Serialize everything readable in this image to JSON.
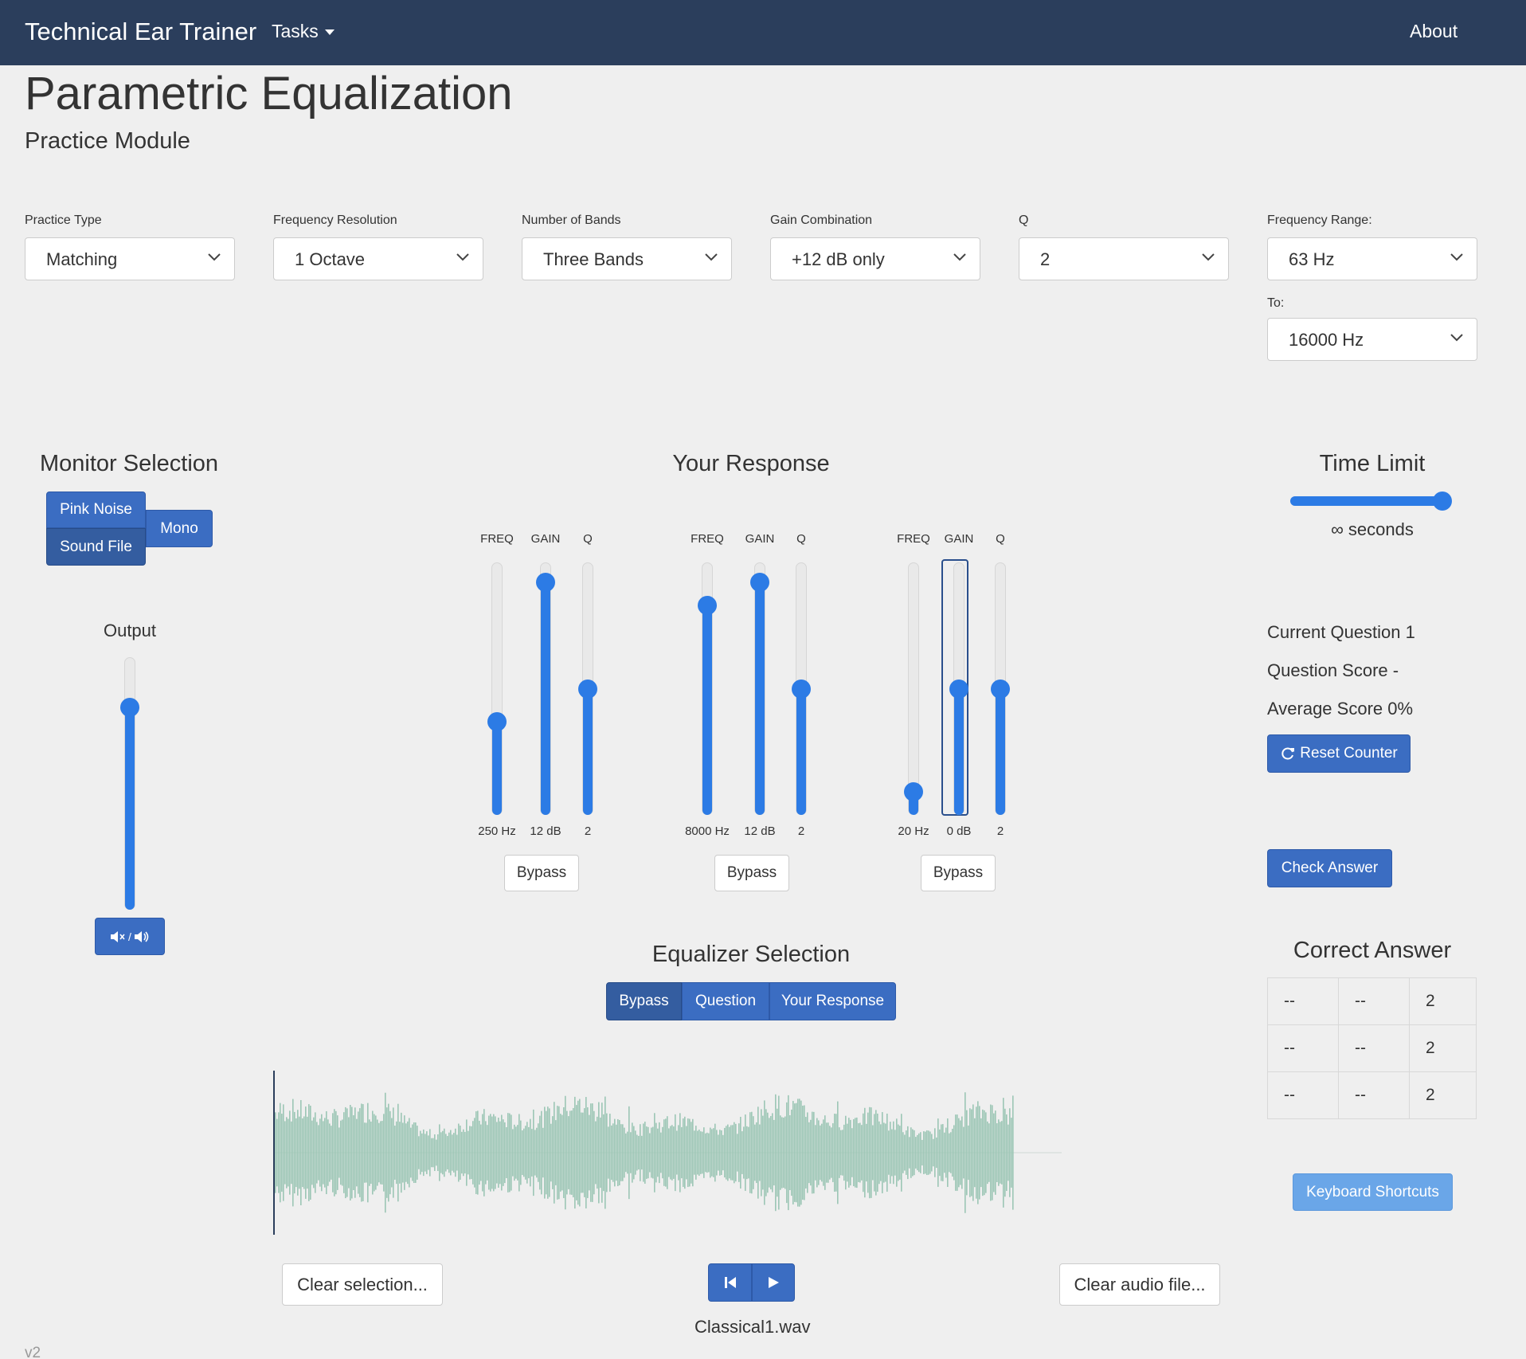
{
  "navbar": {
    "brand": "Technical Ear Trainer",
    "tasks_label": "Tasks",
    "about_label": "About",
    "bg_color": "#2b3e5c"
  },
  "page": {
    "title": "Parametric Equalization",
    "subtitle": "Practice Module",
    "version": "v2"
  },
  "settings": {
    "practice_type": {
      "label": "Practice Type",
      "value": "Matching"
    },
    "frequency_resolution": {
      "label": "Frequency Resolution",
      "value": "1 Octave"
    },
    "number_of_bands": {
      "label": "Number of Bands",
      "value": "Three Bands"
    },
    "gain_combination": {
      "label": "Gain Combination",
      "value": "+12 dB only"
    },
    "q": {
      "label": "Q",
      "value": "2"
    },
    "frequency_range": {
      "label": "Frequency Range:",
      "from_value": "63 Hz",
      "to_label": "To:",
      "to_value": "16000 Hz"
    }
  },
  "monitor": {
    "title": "Monitor Selection",
    "pink_noise": "Pink Noise",
    "sound_file": "Sound File",
    "mono": "Mono",
    "output_label": "Output",
    "output_level": 0.8,
    "mute_icon": "speaker-mute-icon",
    "unmute_icon": "speaker-on-icon",
    "mute_separator": "/"
  },
  "response": {
    "title": "Your Response",
    "col_freq": "FREQ",
    "col_gain": "GAIN",
    "col_q": "Q",
    "bypass_label": "Bypass",
    "bands": [
      {
        "freq": "250 Hz",
        "gain": "12 dB",
        "q": "2",
        "freq_level": 0.37,
        "gain_level": 0.92,
        "q_level": 0.5
      },
      {
        "freq": "8000 Hz",
        "gain": "12 dB",
        "q": "2",
        "freq_level": 0.83,
        "gain_level": 0.92,
        "q_level": 0.5
      },
      {
        "freq": "20 Hz",
        "gain": "0 dB",
        "q": "2",
        "freq_level": 0.09,
        "gain_level": 0.5,
        "q_level": 0.5
      }
    ]
  },
  "equalizer_selection": {
    "title": "Equalizer Selection",
    "options": [
      "Bypass",
      "Question",
      "Your Response"
    ],
    "selected": "Bypass"
  },
  "time_limit": {
    "title": "Time Limit",
    "value_text": "∞ seconds",
    "level": 1.0
  },
  "score": {
    "current_question": "Current Question 1",
    "question_score": "Question Score -",
    "average_score": "Average Score 0%",
    "reset_label": "Reset Counter",
    "reset_icon": "refresh-icon",
    "check_answer": "Check Answer"
  },
  "correct_answer": {
    "title": "Correct Answer",
    "rows": [
      [
        "--",
        "--",
        "2"
      ],
      [
        "--",
        "--",
        "2"
      ],
      [
        "--",
        "--",
        "2"
      ]
    ]
  },
  "keyboard_shortcuts": "Keyboard Shortcuts",
  "player": {
    "clear_selection": "Clear selection...",
    "clear_audio": "Clear audio file...",
    "rewind_icon": "skip-back-icon",
    "play_icon": "play-icon",
    "filename": "Classical1.wav",
    "waveform_color": "#9cc6b5"
  },
  "colors": {
    "accent": "#2c7be5",
    "button_blue": "#3b6dc2",
    "light_button": "#6aa6e8"
  }
}
